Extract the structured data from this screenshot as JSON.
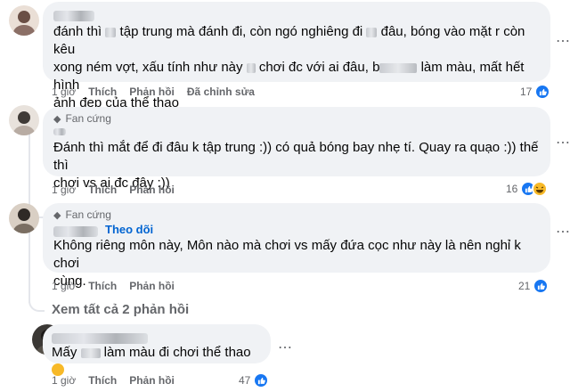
{
  "comments": [
    {
      "text_parts": [
        "đánh thì ",
        "",
        " tập trung mà đánh đi, còn ngó nghiêng đi ",
        "",
        " đâu, bóng vào mặt r còn kêu\nxong ném vợt, xấu tính như này ",
        "",
        " chơi đc với ai đâu, b",
        "",
        " làm màu, mất hết hình\nảnh đẹp của thể thao"
      ],
      "time": "1 giờ",
      "like_label": "Thích",
      "reply_label": "Phản hồi",
      "edited_label": "Đã chỉnh sửa",
      "reaction_count": "17",
      "reactions": [
        "like-icon"
      ]
    },
    {
      "fan_label": "Fan cứng",
      "text": "Đánh thì mắt để đi đâu k tập trung :)) có quả bóng bay nhẹ tí. Quay ra quạo :)) thế thì\nchơi vs ai đc đây :))",
      "time": "1 giờ",
      "like_label": "Thích",
      "reply_label": "Phản hồi",
      "reaction_count": "16",
      "reactions": [
        "like-icon",
        "haha-icon"
      ]
    },
    {
      "fan_label": "Fan cứng",
      "follow_label": "Theo dõi",
      "text": "Không riêng môn này, Môn nào mà chơi vs mấy đứa cọc như này là nên nghỉ k chơi\ncùng.",
      "time": "1 giờ",
      "like_label": "Thích",
      "reply_label": "Phản hồi",
      "reaction_count": "21",
      "reactions": [
        "like-icon"
      ]
    },
    {
      "text_before": "Mấy ",
      "text_after": " làm màu đi chơi thể thao ",
      "time": "1 giờ",
      "like_label": "Thích",
      "reply_label": "Phản hồi",
      "reaction_count": "47",
      "reactions": [
        "like-icon"
      ]
    }
  ],
  "see_all_replies": "Xem tất cả 2 phản hồi",
  "colors": {
    "bubble": "#f0f2f5",
    "link": "#0064d1",
    "meta": "#65676b",
    "like": "#1877f2"
  }
}
